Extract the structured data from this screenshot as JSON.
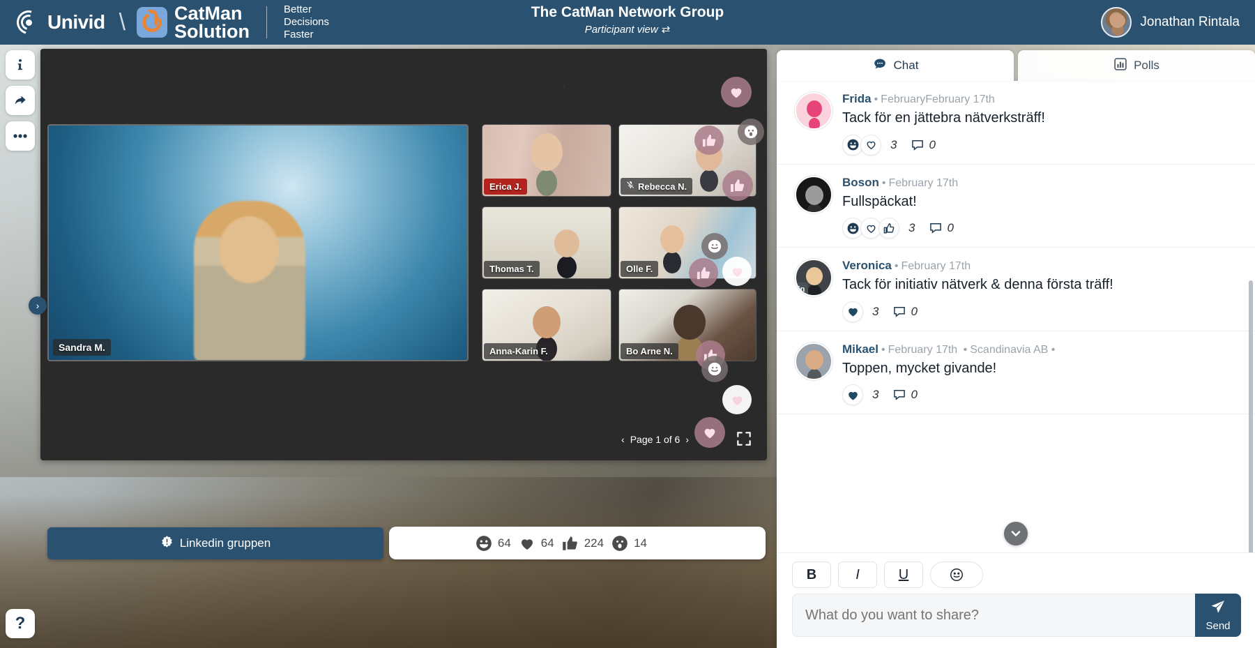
{
  "topbar": {
    "univid_name": "Univid",
    "separator": "\\",
    "catman_line1": "CatMan",
    "catman_line2": "Solution",
    "catman_tagline": "Better\nDecisions\nFaster",
    "title": "The CatMan Network Group",
    "subtitle": "Participant view",
    "subtitle_icon": "swap-arrows-icon",
    "user_name": "Jonathan Rintala",
    "brand_color": "#2a5270"
  },
  "rail": {
    "items": [
      {
        "name": "info-icon",
        "glyph": "i"
      },
      {
        "name": "share-icon",
        "glyph": "share"
      },
      {
        "name": "more-options-icon",
        "glyph": "..."
      }
    ],
    "expand_label": "›",
    "help_label": "?"
  },
  "stage": {
    "speaker_name": "Sandra M.",
    "tiles": [
      {
        "name": "Erica J.",
        "muted": false,
        "active": true
      },
      {
        "name": "Rebecca N.",
        "muted": true,
        "active": false
      },
      {
        "name": "Thomas T.",
        "muted": false,
        "active": false
      },
      {
        "name": "Olle F.",
        "muted": false,
        "active": false
      },
      {
        "name": "Anna-Karin F.",
        "muted": false,
        "active": false
      },
      {
        "name": "Bo Arne N.",
        "muted": false,
        "active": false
      }
    ],
    "pager": {
      "prev": "‹",
      "label": "Page 1 of 6",
      "next": "›"
    },
    "fullscreen_icon": "fullscreen-icon"
  },
  "bottom": {
    "linkedin_label": "Linkedin gruppen",
    "linkedin_icon": "alert-badge-icon",
    "reactions": [
      {
        "icon": "laugh-icon",
        "count": "64"
      },
      {
        "icon": "heart-icon",
        "count": "64"
      },
      {
        "icon": "thumbs-up-icon",
        "count": "224"
      },
      {
        "icon": "surprised-icon",
        "count": "14"
      }
    ]
  },
  "panel": {
    "tabs": [
      {
        "label": "Chat",
        "icon": "chat-bubble-icon",
        "active": true
      },
      {
        "label": "Polls",
        "icon": "bar-chart-icon",
        "active": false
      }
    ],
    "messages": [
      {
        "author": "Frida",
        "time": "FebruaryFebruary 17th",
        "org": "",
        "text": "Tack för en jättebra nätverksträff!",
        "reactions": [
          "laugh-icon",
          "heart-icon"
        ],
        "reaction_count": "3",
        "comment_count": "0",
        "linkedin": false
      },
      {
        "author": "Boson",
        "time": "February 17th",
        "org": "",
        "text": "Fullspäckat!",
        "reactions": [
          "laugh-icon",
          "heart-icon",
          "thumbs-up-icon"
        ],
        "reaction_count": "3",
        "comment_count": "0",
        "linkedin": false
      },
      {
        "author": "Veronica",
        "time": "February 17th",
        "org": "",
        "text": "Tack för initiativ nätverk & denna första träff!",
        "reactions": [
          "heart-filled-icon"
        ],
        "reaction_count": "3",
        "comment_count": "0",
        "linkedin": true
      },
      {
        "author": "Mikael",
        "time": "February 17th",
        "org": "Scandinavia AB •",
        "text": "Toppen, mycket givande!",
        "reactions": [
          "heart-filled-icon"
        ],
        "reaction_count": "3",
        "comment_count": "0",
        "linkedin": false
      }
    ],
    "scroll_down_icon": "chevron-down-icon",
    "composer": {
      "bold": "B",
      "italic": "I",
      "underline": "U",
      "emoji_icon": "smiley-icon",
      "placeholder": "What do you want to share?",
      "send_label": "Send",
      "send_icon": "paper-plane-icon"
    }
  }
}
